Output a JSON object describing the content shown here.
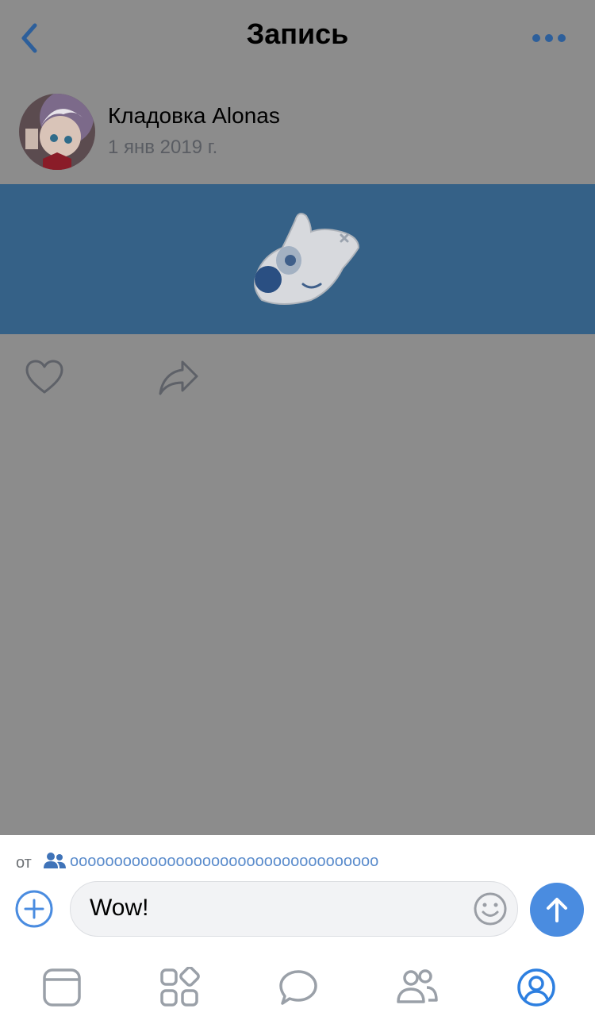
{
  "header": {
    "title": "Запись"
  },
  "post": {
    "author_name": "Кладовка Alonas",
    "date": "1 янв 2019 г."
  },
  "composer": {
    "from_label": "от",
    "from_group": "ооооооооооооооооооооооооооооооооооо",
    "input_value": "Wow!"
  },
  "colors": {
    "accent": "#4a8ce0",
    "banner": "#356187",
    "dimmed_background": "#8c8c8c"
  },
  "tabs": [
    {
      "icon": "news-icon"
    },
    {
      "icon": "services-icon"
    },
    {
      "icon": "messages-icon"
    },
    {
      "icon": "friends-icon"
    },
    {
      "icon": "profile-icon",
      "active": true
    }
  ]
}
